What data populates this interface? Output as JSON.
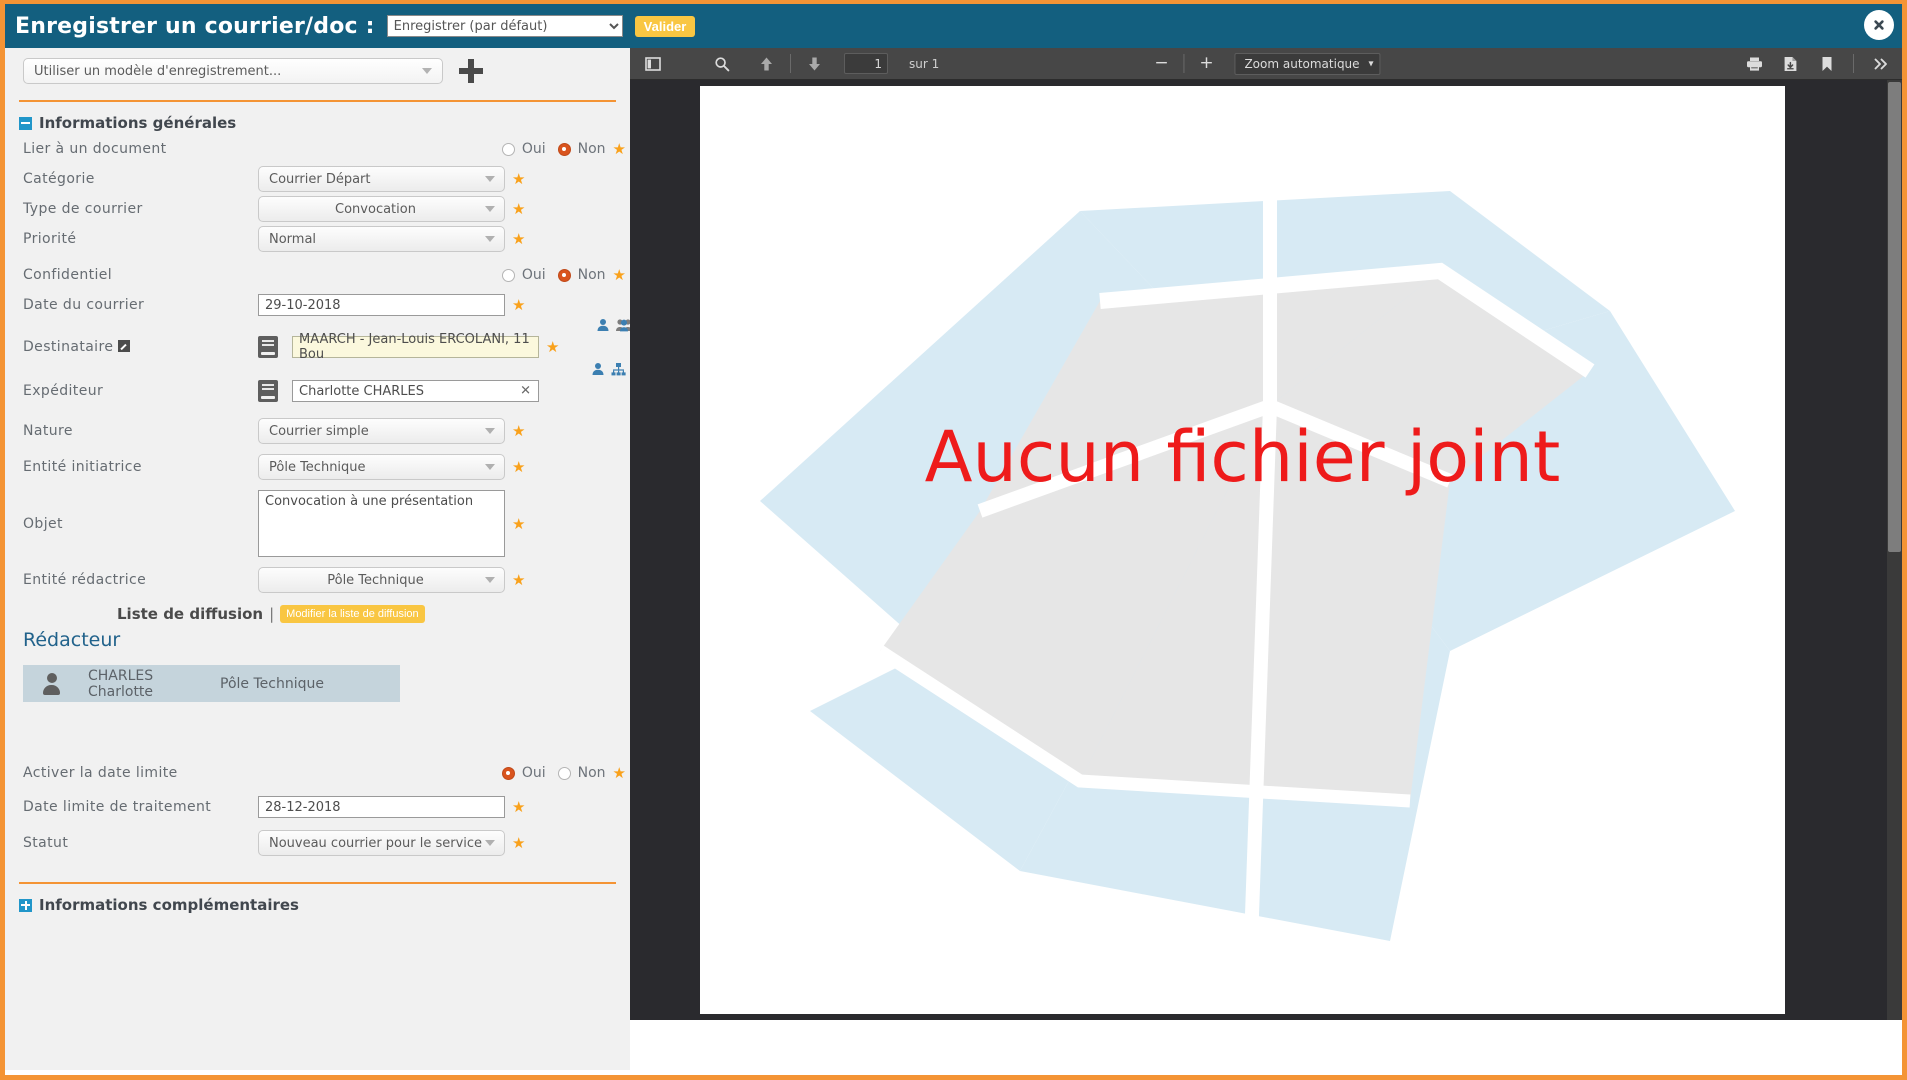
{
  "header": {
    "title": "Enregistrer un courrier/doc :",
    "action_select_value": "Enregistrer (par défaut)",
    "validate_label": "Valider",
    "close_icon": "close-circle-icon"
  },
  "form": {
    "template_select_value": "Utiliser un modèle d'enregistrement...",
    "add_icon": "plus-icon",
    "sections": {
      "general": "Informations générales",
      "complementary": "Informations complémentaires"
    },
    "labels": {
      "link_doc": "Lier à un document",
      "category": "Catégorie",
      "mail_type": "Type de courrier",
      "priority": "Priorité",
      "confidential": "Confidentiel",
      "mail_date": "Date du courrier",
      "recipient": "Destinataire",
      "sender": "Expéditeur",
      "nature": "Nature",
      "initiating_entity": "Entité initiatrice",
      "object": "Objet",
      "writing_entity": "Entité rédactrice",
      "activate_deadline": "Activer la date limite",
      "deadline_date": "Date limite de traitement",
      "status": "Statut"
    },
    "values": {
      "category": "Courrier Départ",
      "mail_type": "Convocation",
      "priority": "Normal",
      "mail_date": "29-10-2018",
      "recipient": "MAARCH - Jean-Louis ERCOLANI, 11 Bou",
      "sender": "Charlotte CHARLES",
      "nature": "Courrier simple",
      "initiating_entity": "Pôle Technique",
      "object": "Convocation à une présentation",
      "writing_entity": "Pôle Technique",
      "deadline_date": "28-12-2018",
      "status": "Nouveau courrier pour le service"
    },
    "radio": {
      "yes": "Oui",
      "no": "Non",
      "link_doc_selected": "Non",
      "confidential_selected": "Non",
      "deadline_selected": "Oui"
    },
    "clear_sender_icon": "clear-x-icon",
    "diffusion": {
      "title": "Liste de diffusion",
      "separator": "|",
      "edit_button": "Modifier la liste de diffusion",
      "redacteur_title": "Rédacteur",
      "redacteur_name": "CHARLES Charlotte",
      "redacteur_entity": "Pôle Technique"
    }
  },
  "viewer": {
    "toolbar": {
      "sidebar_icon": "sidebar-toggle-icon",
      "find_icon": "search-icon",
      "prev_icon": "arrow-up-icon",
      "next_icon": "arrow-down-icon",
      "page_number": "1",
      "page_total": "sur 1",
      "zoom_out_icon": "minus-icon",
      "zoom_in_icon": "plus-icon",
      "zoom_value": "Zoom automatique",
      "print_icon": "print-icon",
      "download_icon": "download-icon",
      "bookmark_icon": "bookmark-icon",
      "more_icon": "chevron-double-right-icon"
    },
    "no_file_message": "Aucun fichier joint"
  },
  "colors": {
    "header_bg": "#135f7f",
    "accent_orange": "#f49435",
    "button_yellow": "#f9c642",
    "radio_selected": "#d9541e",
    "star": "#f9a11b",
    "error_red": "#ee1b1b",
    "redacteur_card": "#c5d4dc",
    "toolbar_bg": "#474747",
    "viewer_bg": "#2a2a2e"
  }
}
